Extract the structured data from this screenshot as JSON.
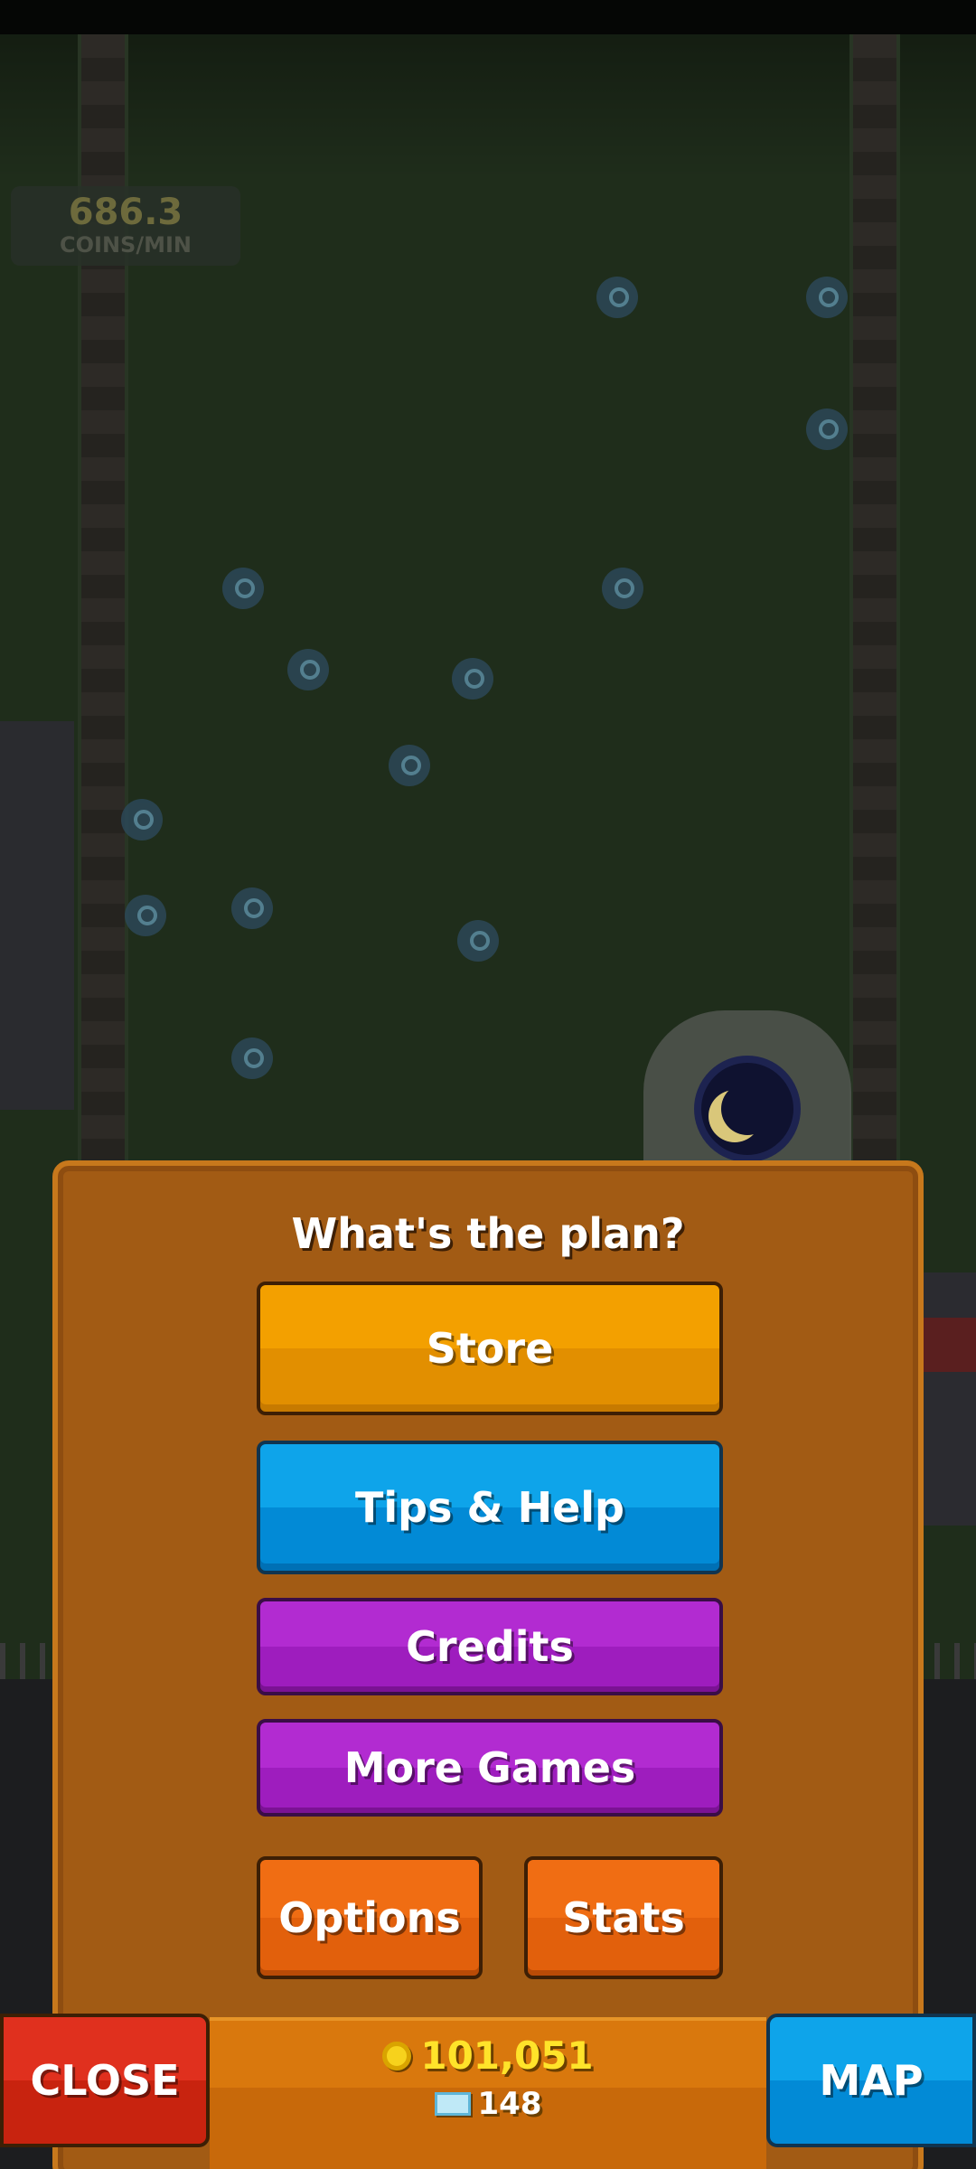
{
  "hud": {
    "coins_per_min_value": "686.3",
    "coins_per_min_label": "COINS/MIN"
  },
  "menu": {
    "title": "What's the plan?",
    "buttons": {
      "store": "Store",
      "tips_help": "Tips & Help",
      "credits": "Credits",
      "more_games": "More Games",
      "options": "Options",
      "stats": "Stats"
    }
  },
  "bottom_bar": {
    "close_label": "CLOSE",
    "map_label": "MAP",
    "coins": "101,051",
    "gems": "148"
  },
  "icons": {
    "coin": "coin-icon",
    "gem": "gem-icon",
    "moon_clock": "moon-clock-icon"
  },
  "colors": {
    "panel": "#a25b14",
    "store": "#f3a000",
    "tips": "#0ea4ea",
    "purple": "#b22bd1",
    "orange": "#f06d13",
    "close": "#e0301e",
    "coin_text": "#ffe32a"
  }
}
